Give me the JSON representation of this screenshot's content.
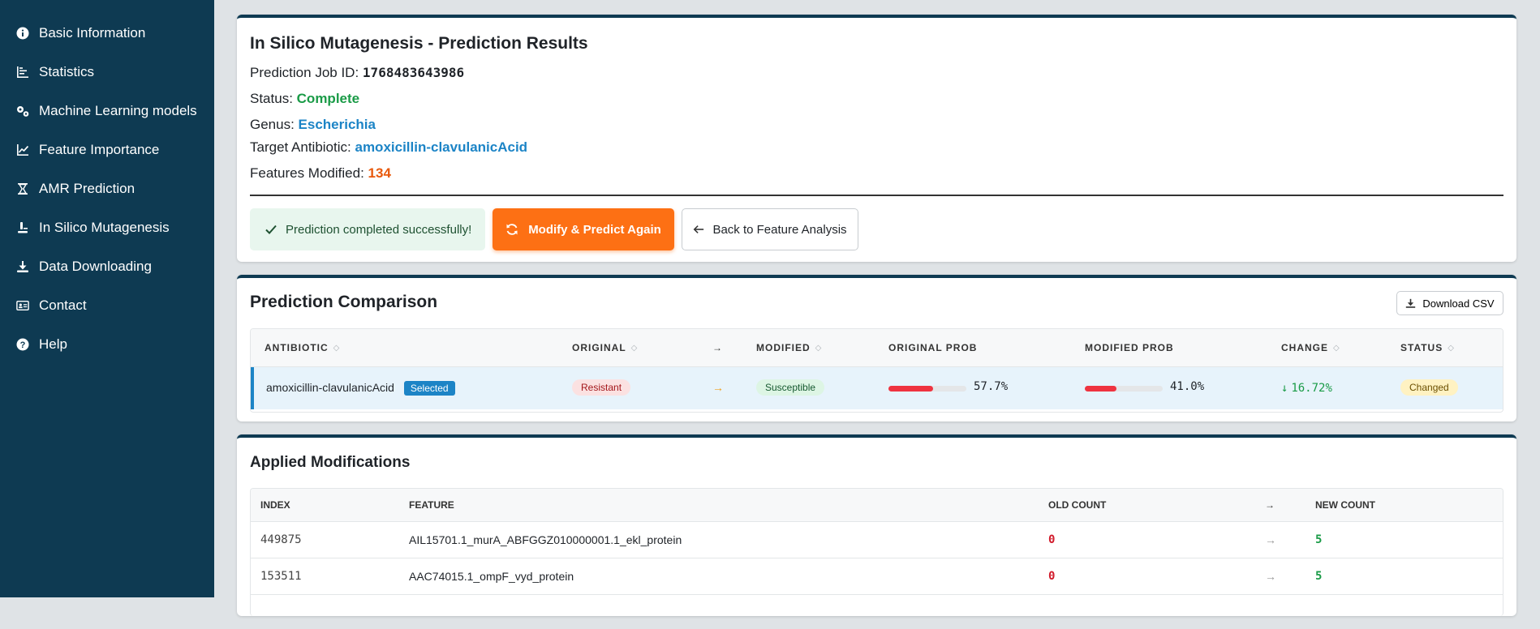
{
  "sidebar": {
    "items": [
      {
        "label": "Basic Information",
        "icon": "info-icon"
      },
      {
        "label": "Statistics",
        "icon": "bar-chart-icon"
      },
      {
        "label": "Machine Learning models",
        "icon": "gears-icon"
      },
      {
        "label": "Feature Importance",
        "icon": "line-chart-icon"
      },
      {
        "label": "AMR Prediction",
        "icon": "hourglass-icon"
      },
      {
        "label": "In Silico Mutagenesis",
        "icon": "mutation-icon"
      },
      {
        "label": "Data Downloading",
        "icon": "download-icon"
      },
      {
        "label": "Contact",
        "icon": "contact-card-icon"
      },
      {
        "label": "Help",
        "icon": "help-icon"
      }
    ]
  },
  "results": {
    "title": "In Silico Mutagenesis - Prediction Results",
    "job_label": "Prediction Job ID:",
    "job_id": "1768483643986",
    "status_label": "Status:",
    "status": "Complete",
    "genus_label": "Genus:",
    "genus": "Escherichia",
    "antibiotic_label": "Target Antibiotic:",
    "antibiotic": "amoxicillin-clavulanicAcid",
    "features_label": "Features Modified:",
    "features_modified": "134",
    "alert": "Prediction completed successfully!",
    "modify_button": "Modify & Predict Again",
    "back_button": "Back to Feature Analysis"
  },
  "comparison": {
    "title": "Prediction Comparison",
    "download_button": "Download CSV",
    "headers": {
      "antibiotic": "ANTIBIOTIC",
      "original": "ORIGINAL",
      "arrow": "→",
      "modified": "MODIFIED",
      "original_prob": "ORIGINAL PROB",
      "modified_prob": "MODIFIED PROB",
      "change": "CHANGE",
      "status": "STATUS"
    },
    "row": {
      "antibiotic": "amoxicillin-clavulanicAcid",
      "selected_badge": "Selected",
      "original": "Resistant",
      "arrow": "→",
      "modified": "Susceptible",
      "original_prob": 0.577,
      "original_prob_text": "57.7%",
      "modified_prob": 0.41,
      "modified_prob_text": "41.0%",
      "change_arrow": "↓",
      "change": "16.72%",
      "status": "Changed"
    },
    "colors": {
      "prob_bar": "#ef3340",
      "accent": "#1c84c6"
    }
  },
  "modifications": {
    "title": "Applied Modifications",
    "headers": {
      "index": "INDEX",
      "feature": "FEATURE",
      "old": "OLD COUNT",
      "arrow": "→",
      "new": "NEW COUNT"
    },
    "rows": [
      {
        "index": "449875",
        "feature": "AIL15701.1_murA_ABFGGZ010000001.1_ekl_protein",
        "old": "0",
        "arrow": "→",
        "new": "5"
      },
      {
        "index": "153511",
        "feature": "AAC74015.1_ompF_vyd_protein",
        "old": "0",
        "arrow": "→",
        "new": "5"
      }
    ]
  },
  "colors": {
    "sidebar_bg": "#0e3a52",
    "primary": "#fd7014",
    "success": "#1a9b47",
    "link": "#1c84c6"
  }
}
